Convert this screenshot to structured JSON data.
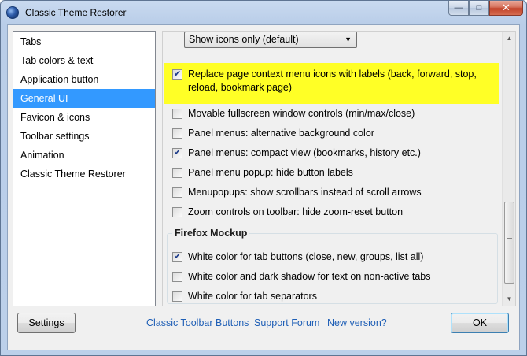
{
  "window": {
    "title": "Classic Theme Restorer"
  },
  "nav": {
    "items": [
      {
        "label": "Tabs"
      },
      {
        "label": "Tab colors & text"
      },
      {
        "label": "Application button"
      },
      {
        "label": "General UI",
        "selected": true
      },
      {
        "label": "Favicon & icons"
      },
      {
        "label": "Toolbar settings"
      },
      {
        "label": "Animation"
      },
      {
        "label": "Classic Theme Restorer"
      }
    ]
  },
  "pane": {
    "select_value": "Show icons only (default)",
    "options": [
      {
        "label": "Replace page context menu icons with labels (back, forward, stop, reload, bookmark page)",
        "checked": true,
        "highlighted": true
      },
      {
        "label": "Movable fullscreen window controls (min/max/close)",
        "checked": false
      },
      {
        "label": "Panel menus: alternative background color",
        "checked": false
      },
      {
        "label": "Panel menus: compact view (bookmarks, history etc.)",
        "checked": true
      },
      {
        "label": "Panel menu popup: hide button labels",
        "checked": false
      },
      {
        "label": "Menupopups: show scrollbars instead of scroll arrows",
        "checked": false
      },
      {
        "label": "Zoom controls on toolbar: hide zoom-reset button",
        "checked": false
      }
    ],
    "group": {
      "title": "Firefox Mockup",
      "options": [
        {
          "label": "White color for tab buttons (close, new, groups, list all)",
          "checked": true
        },
        {
          "label": "White color and dark shadow for text on non-active tabs",
          "checked": false
        },
        {
          "label": "White color for tab separators",
          "checked": false
        }
      ]
    }
  },
  "footer": {
    "settings_label": "Settings",
    "links": [
      "Classic Toolbar Buttons",
      "Support Forum",
      "New version?"
    ],
    "ok_label": "OK"
  },
  "colors": {
    "selection": "#3399ff",
    "highlight": "#ffff26",
    "link": "#1f5fb6"
  }
}
